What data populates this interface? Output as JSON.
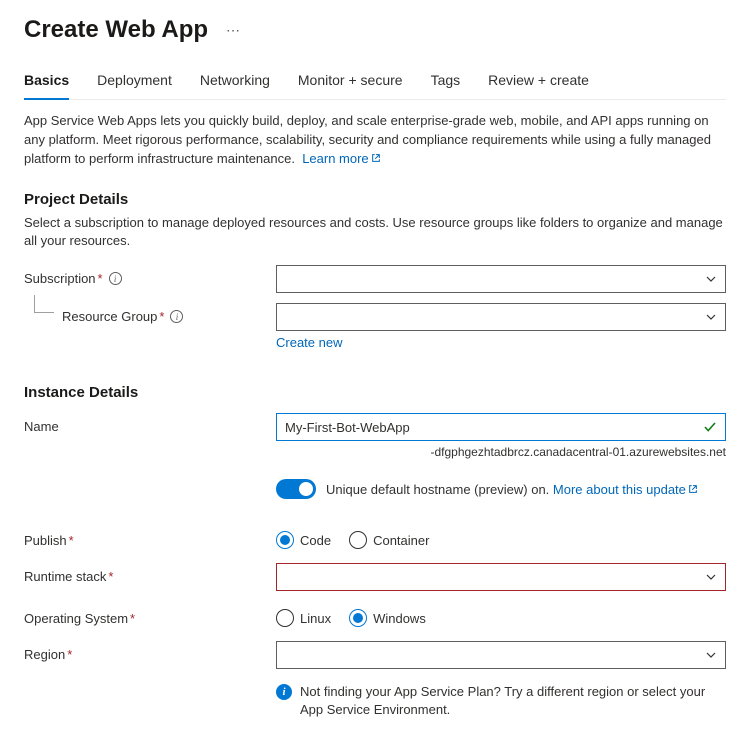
{
  "header": {
    "title": "Create Web App"
  },
  "tabs": [
    {
      "label": "Basics",
      "active": true
    },
    {
      "label": "Deployment"
    },
    {
      "label": "Networking"
    },
    {
      "label": "Monitor + secure"
    },
    {
      "label": "Tags"
    },
    {
      "label": "Review + create"
    }
  ],
  "intro": {
    "text": "App Service Web Apps lets you quickly build, deploy, and scale enterprise-grade web, mobile, and API apps running on any platform. Meet rigorous performance, scalability, security and compliance requirements while using a fully managed platform to perform infrastructure maintenance.",
    "learn_more": "Learn more"
  },
  "project_details": {
    "heading": "Project Details",
    "desc": "Select a subscription to manage deployed resources and costs. Use resource groups like folders to organize and manage all your resources.",
    "subscription_label": "Subscription",
    "resource_group_label": "Resource Group",
    "create_new": "Create new"
  },
  "instance_details": {
    "heading": "Instance Details",
    "name_label": "Name",
    "name_value": "My-First-Bot-WebApp",
    "hostname_suffix": "-dfgphgezhtadbrcz.canadacentral-01.azurewebsites.net",
    "toggle_label": "Unique default hostname (preview) on.",
    "toggle_link": "More about this update",
    "publish_label": "Publish",
    "publish_options": {
      "code": "Code",
      "container": "Container"
    },
    "runtime_label": "Runtime stack",
    "os_label": "Operating System",
    "os_options": {
      "linux": "Linux",
      "windows": "Windows"
    },
    "region_label": "Region",
    "region_hint": "Not finding your App Service Plan? Try a different region or select your App Service Environment."
  }
}
